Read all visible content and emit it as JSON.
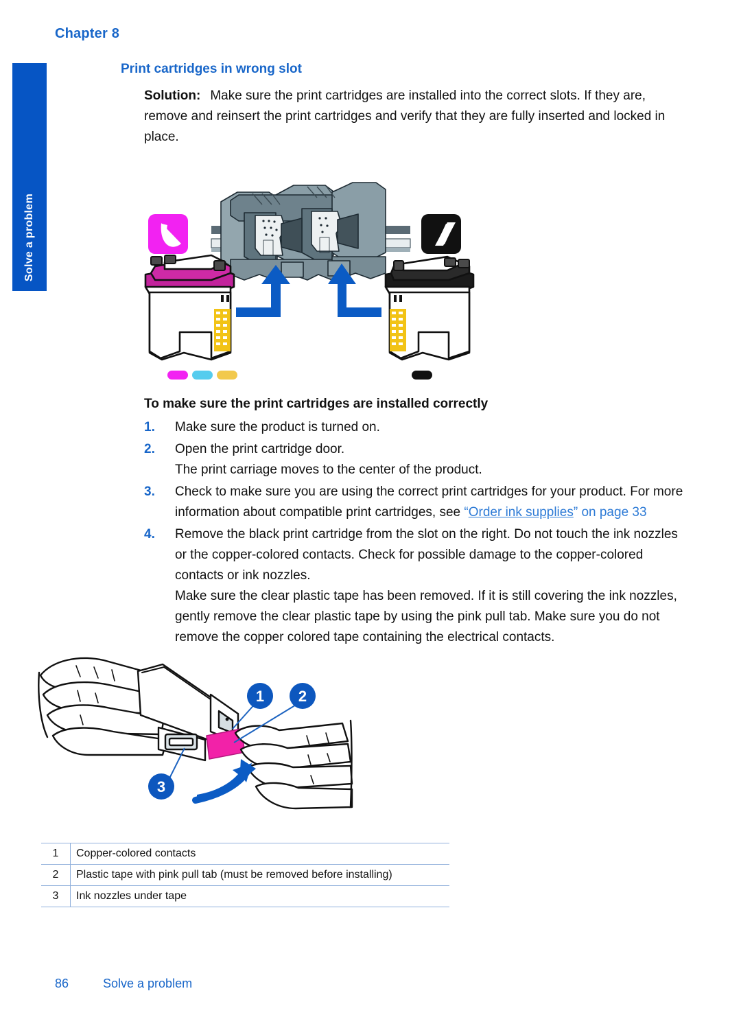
{
  "page": {
    "chapter_label": "Chapter 8",
    "side_tab_label": "Solve a problem",
    "footer_page_number": "86",
    "footer_section": "Solve a problem"
  },
  "section": {
    "heading": "Print cartridges in wrong slot"
  },
  "solution": {
    "label": "Solution:",
    "text": "Make sure the print cartridges are installed into the correct slots. If they are, remove and reinsert the print cartridges and verify that they are fully inserted and locked in place."
  },
  "figure_cartridges": {
    "alt": "Print carriage with two slots and color and black print cartridges below, blue arrows pointing into slots",
    "color_badge": "magenta-crescent-icon",
    "black_badge": "black-parallelogram-icon",
    "color_dots": [
      "magenta",
      "cyan",
      "yellow"
    ],
    "black_dot": "black"
  },
  "procedure": {
    "heading": "To make sure the print cartridges are installed correctly",
    "steps": [
      {
        "num": "1.",
        "text": "Make sure the product is turned on.",
        "sub": ""
      },
      {
        "num": "2.",
        "text": "Open the print cartridge door.",
        "sub": "The print carriage moves to the center of the product."
      },
      {
        "num": "3.",
        "text_before": "Check to make sure you are using the correct print cartridges for your product. For more information about compatible print cartridges, see ",
        "link_open_quote": "“",
        "link_text": "Order ink supplies",
        "link_close_quote": "”",
        "link_page_ref": " on page 33"
      },
      {
        "num": "4.",
        "text": "Remove the black print cartridge from the slot on the right. Do not touch the ink nozzles or the copper-colored contacts. Check for possible damage to the copper-colored contacts or ink nozzles.",
        "sub": "Make sure the clear plastic tape has been removed. If it is still covering the ink nozzles, gently remove the clear plastic tape by using the pink pull tab. Make sure you do not remove the copper colored tape containing the electrical contacts."
      }
    ]
  },
  "figure_hands": {
    "alt": "Two hands holding a print cartridge and peeling the pink plastic pull tab",
    "callouts": [
      "1",
      "2",
      "3"
    ]
  },
  "legend": {
    "rows": [
      {
        "num": "1",
        "text": "Copper-colored contacts"
      },
      {
        "num": "2",
        "text": "Plastic tape with pink pull tab (must be removed before installing)"
      },
      {
        "num": "3",
        "text": "Ink nozzles under tape"
      }
    ]
  },
  "colors": {
    "brand_blue": "#0655C4",
    "heading_blue": "#1866C9",
    "link_blue": "#2E7BD6",
    "table_rule": "#8FAFDB",
    "magenta": "#F222F2",
    "cyan": "#55CCEE",
    "yellow": "#F2C94C",
    "arrow_blue": "#0B5BC4"
  }
}
